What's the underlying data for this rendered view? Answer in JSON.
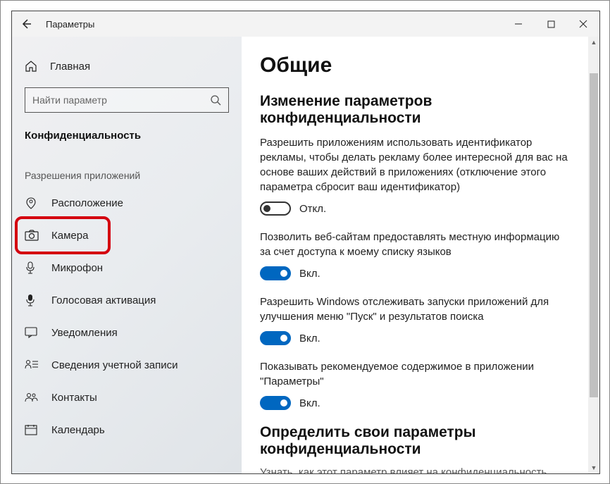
{
  "titlebar": {
    "title": "Параметры"
  },
  "sidebar": {
    "home": "Главная",
    "search_placeholder": "Найти параметр",
    "category": "Конфиденциальность",
    "group": "Разрешения приложений",
    "items": [
      {
        "label": "Расположение",
        "icon": "location"
      },
      {
        "label": "Камера",
        "icon": "camera",
        "highlighted": true
      },
      {
        "label": "Микрофон",
        "icon": "microphone"
      },
      {
        "label": "Голосовая активация",
        "icon": "voice"
      },
      {
        "label": "Уведомления",
        "icon": "notification"
      },
      {
        "label": "Сведения учетной записи",
        "icon": "account"
      },
      {
        "label": "Контакты",
        "icon": "contacts"
      },
      {
        "label": "Календарь",
        "icon": "calendar"
      }
    ]
  },
  "main": {
    "heading": "Общие",
    "section1_title": "Изменение параметров конфиденциальности",
    "settings": [
      {
        "desc": "Разрешить приложениям использовать идентификатор рекламы, чтобы делать рекламу более интересной для вас на основе ваших действий в приложениях (отключение этого параметра сбросит ваш идентификатор)",
        "state": "off",
        "state_label": "Откл."
      },
      {
        "desc": "Позволить веб-сайтам предоставлять местную информацию за счет доступа к моему списку языков",
        "state": "on",
        "state_label": "Вкл."
      },
      {
        "desc": "Разрешить Windows отслеживать запуски приложений для улучшения меню \"Пуск\" и результатов поиска",
        "state": "on",
        "state_label": "Вкл."
      },
      {
        "desc": "Показывать рекомендуемое содержимое в приложении \"Параметры\"",
        "state": "on",
        "state_label": "Вкл."
      }
    ],
    "section2_title": "Определить свои параметры конфиденциальности",
    "footnote": "Узнать, как этот параметр влияет на конфиденциальность."
  }
}
